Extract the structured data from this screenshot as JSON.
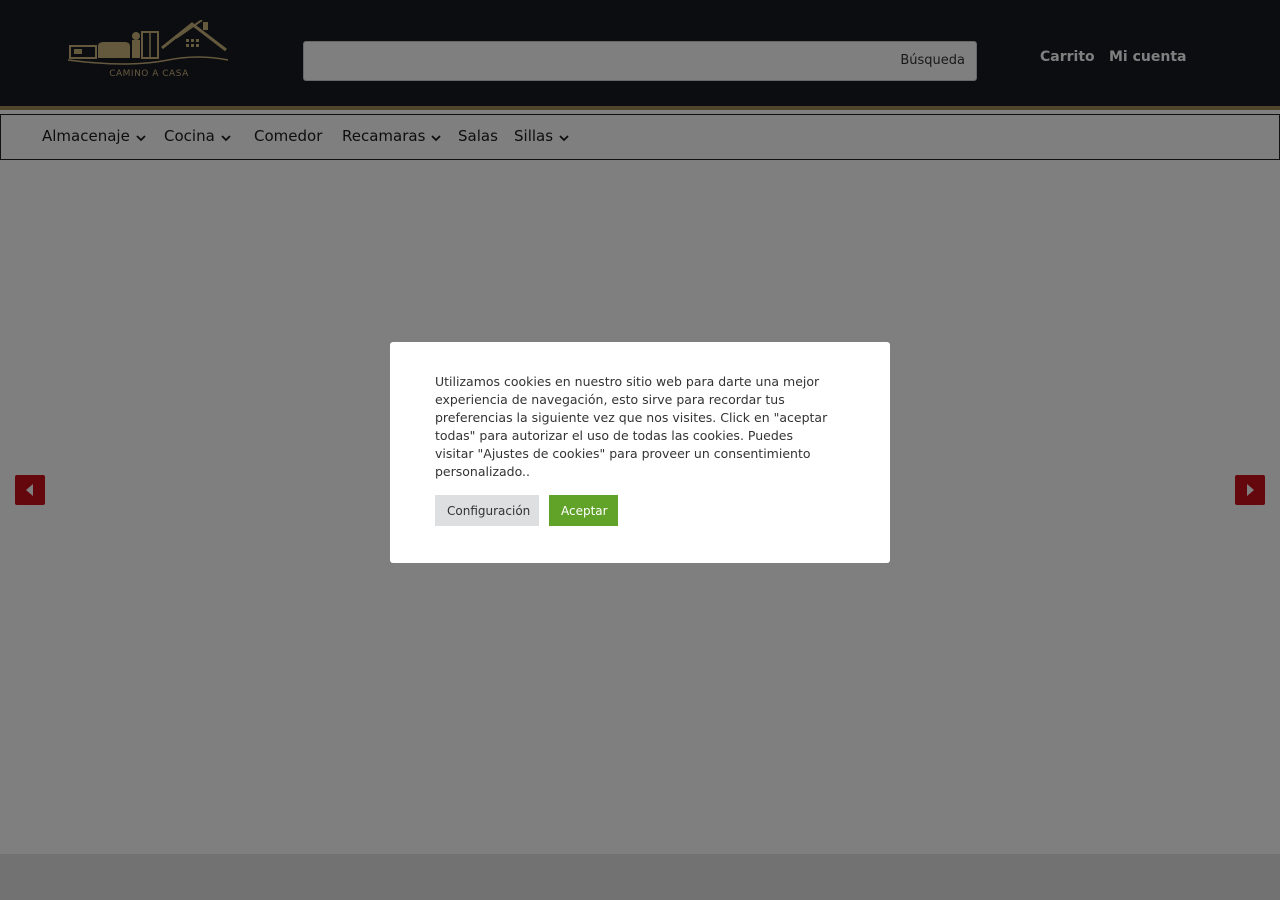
{
  "header": {
    "logo_text": "CAMINO A CASA",
    "search_placeholder": "",
    "search_label": "Búsqueda",
    "cart_label": "Carrito",
    "account_label": "Mi cuenta"
  },
  "nav": {
    "items": [
      {
        "label": "Almacenaje",
        "has_dropdown": true
      },
      {
        "label": "Cocina",
        "has_dropdown": true
      },
      {
        "label": "Comedor",
        "has_dropdown": false
      },
      {
        "label": "Recamaras",
        "has_dropdown": true
      },
      {
        "label": "Salas",
        "has_dropdown": false
      },
      {
        "label": "Sillas",
        "has_dropdown": true
      }
    ]
  },
  "slider": {
    "prev_icon": "triangle-left-icon",
    "next_icon": "triangle-right-icon"
  },
  "cookie_banner": {
    "message": "Utilizamos cookies en nuestro sitio web para darte una mejor experiencia de navegación, esto sirve para recordar tus preferencias la siguiente vez que nos visites. Click en \"aceptar todas\" para autorizar el uso de todas las cookies. Puedes visitar \"Ajustes de cookies\" para proveer un consentimiento personalizado..",
    "settings_label": "Configuración",
    "accept_label": "Aceptar"
  },
  "colors": {
    "header_bg": "#181b23",
    "gold_accent": "#a08b55",
    "arrow_red": "#c8101c",
    "accept_green": "#61a229"
  }
}
